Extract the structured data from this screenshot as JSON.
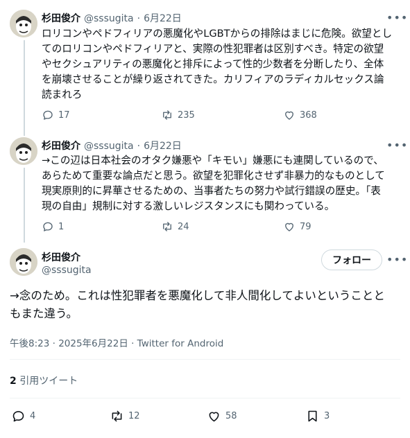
{
  "tweets": [
    {
      "name": "杉田俊介",
      "handle": "@sssugita",
      "dot": "·",
      "date": "6月22日",
      "lines": [
        "ロリコンやペドフィリアの悪魔化やLGBTからの排除はまじに危険。欲望とし",
        "てのロリコンやペドフィリアと、実際の性犯罪者は区別すべき。特定の欲望",
        "やセクシュアリティの悪魔化と排斥によって性的少数者を分断したり、全体",
        "を崩壊させることが繰り返されてきた。カリフィアのラディカルセックス論",
        "読まれろ"
      ],
      "replies": "17",
      "retweets": "235",
      "likes": "368"
    },
    {
      "name": "杉田俊介",
      "handle": "@sssugita",
      "dot": "·",
      "date": "6月22日",
      "lines": [
        "→この辺は日本社会のオタク嫌悪や「キモい」嫌悪にも連関しているので、",
        "あらためて重要な論点だと思う。欲望を犯罪化させず非暴力的なものとして",
        "現実原則的に昇華させるための、当事者たちの努力や試行錯誤の歴史。「表",
        "現の自由」規制に対する激しいレジスタンスにも関わっている。"
      ],
      "replies": "1",
      "retweets": "24",
      "likes": "79"
    }
  ],
  "main": {
    "name": "杉田俊介",
    "handle": "@sssugita",
    "follow_label": "フォロー",
    "lines": [
      "→念のため。これは性犯罪者を悪魔化して非人間化してよいということと",
      "もまた違う。"
    ],
    "meta": "午後8:23 · 2025年6月22日 · Twitter for Android",
    "quote_count": "2",
    "quote_label": "引用ツイート",
    "replies": "4",
    "retweets": "12",
    "likes": "58",
    "bookmarks": "3"
  },
  "icons": {
    "more": "more-dots-icon",
    "reply": "reply-bubble-icon",
    "retweet": "retweet-arrows-icon",
    "like": "heart-icon",
    "bookmark": "bookmark-icon"
  },
  "colors": {
    "text": "#0f1419",
    "secondary": "#536471",
    "border": "#cfd9de"
  }
}
